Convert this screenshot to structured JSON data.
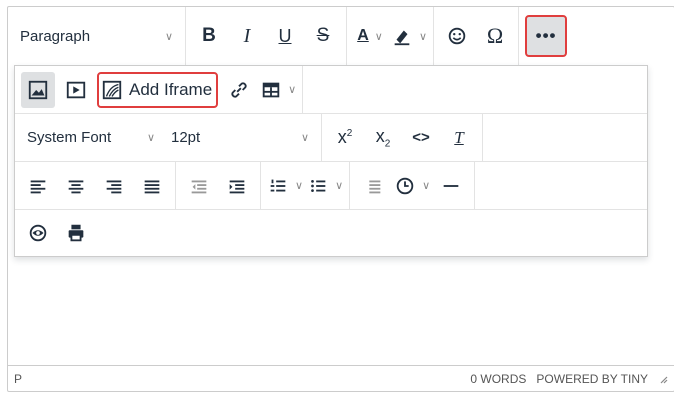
{
  "toolbar": {
    "block_format": "Paragraph",
    "bold": "B",
    "italic": "I",
    "underline": "U",
    "strikethrough": "S",
    "text_color_letter": "A",
    "special_char": "Ω",
    "more": "•••"
  },
  "drawer": {
    "add_iframe_label": "Add Iframe",
    "font_family": "System Font",
    "font_size": "12pt",
    "superscript_base": "x",
    "superscript_exp": "2",
    "subscript_base": "x",
    "subscript_idx": "2",
    "code": "<>",
    "clear_format": "T"
  },
  "statusbar": {
    "path": "P",
    "word_count": "0 WORDS",
    "branding": "POWERED BY TINY"
  },
  "colors": {
    "highlight_border": "#e03e3e",
    "active_bg": "#dee0e2",
    "border": "#cccccc",
    "icon": "#222f3e"
  },
  "icons": [
    "image-icon",
    "media-icon",
    "iframe-icon",
    "link-icon",
    "table-icon",
    "align-left-icon",
    "align-center-icon",
    "align-right-icon",
    "align-justify-icon",
    "outdent-icon",
    "indent-icon",
    "numbered-list-icon",
    "bullet-list-icon",
    "line-height-icon",
    "clock-icon",
    "horizontal-rule-icon",
    "preview-icon",
    "print-icon",
    "emoticons-icon",
    "highlight-icon",
    "more-icon"
  ]
}
